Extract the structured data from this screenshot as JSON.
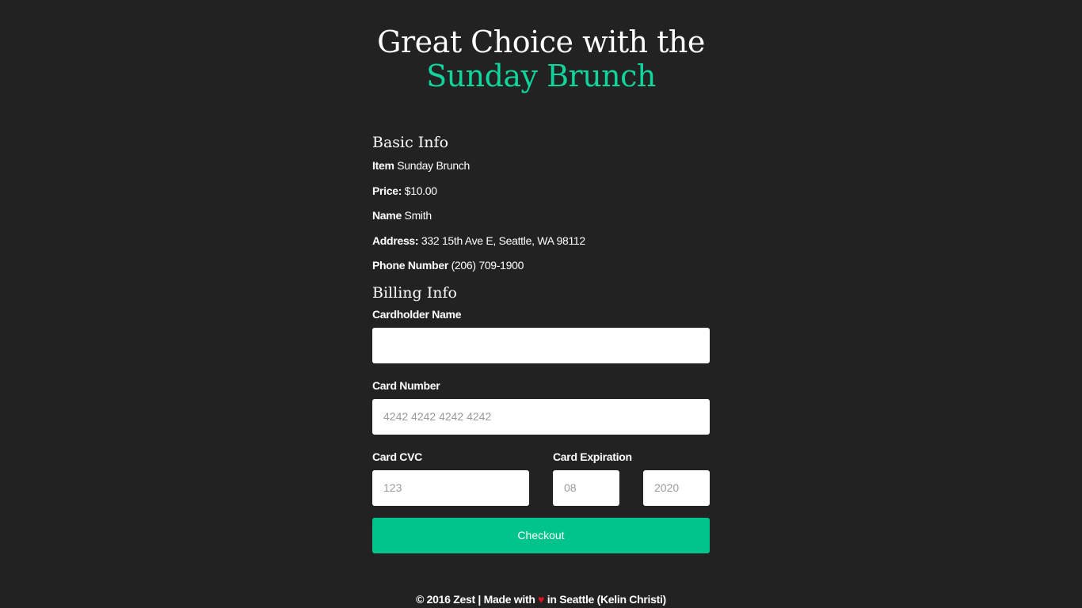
{
  "header": {
    "title_line1": "Great Choice with the",
    "title_line2": "Sunday Brunch"
  },
  "basic_info": {
    "heading": "Basic Info",
    "items": [
      {
        "label": "Item",
        "value": "Sunday Brunch"
      },
      {
        "label": "Price:",
        "value": "$10.00"
      },
      {
        "label": "Name",
        "value": "Smith"
      },
      {
        "label": "Address:",
        "value": "332 15th Ave E, Seattle, WA 98112"
      },
      {
        "label": "Phone Number",
        "value": "(206) 709-1900"
      }
    ]
  },
  "billing_info": {
    "heading": "Billing Info",
    "cardholder_name": {
      "label": "Cardholder Name",
      "value": "",
      "placeholder": ""
    },
    "card_number": {
      "label": "Card Number",
      "value": "",
      "placeholder": "4242 4242 4242 4242"
    },
    "card_cvc": {
      "label": "Card CVC",
      "value": "",
      "placeholder": "123"
    },
    "card_expiration": {
      "label": "Card Expiration",
      "month_placeholder": "08",
      "year_placeholder": "2020"
    },
    "checkout_label": "Checkout"
  },
  "footer": {
    "text_before": "© 2016 Zest | Made with",
    "heart": "♥",
    "text_after": "in Seattle (Kelin Christi)"
  },
  "colors": {
    "background": "#222222",
    "accent": "#10d49c",
    "button": "#00c48c",
    "heart": "#e4151f"
  }
}
